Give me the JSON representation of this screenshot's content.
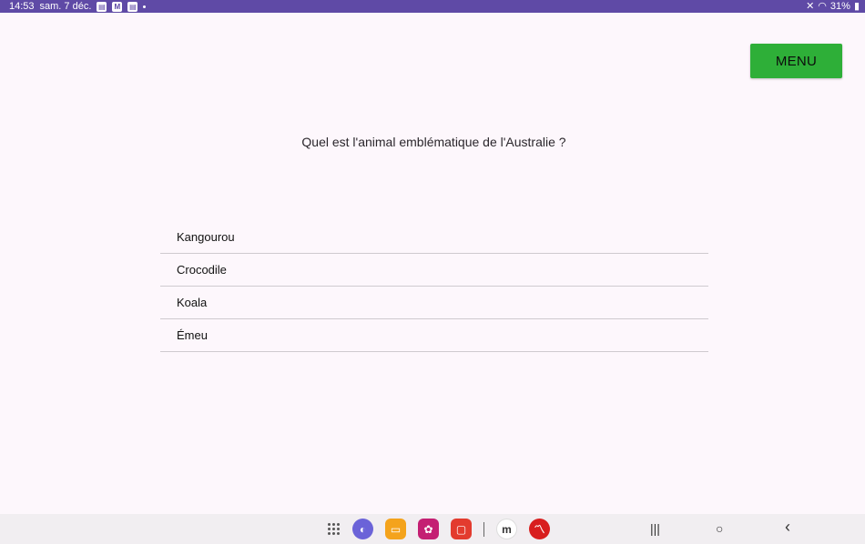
{
  "status_bar": {
    "time": "14:53",
    "date": "sam. 7 déc.",
    "battery": "31%"
  },
  "menu": {
    "label": "MENU"
  },
  "question": "Quel est l'animal emblématique de l'Australie ?",
  "answers": [
    "Kangourou",
    "Crocodile",
    "Koala",
    "Émeu"
  ],
  "colors": {
    "status_bar": "#5f4aa6",
    "menu_button": "#2eaf38",
    "background": "#fdf7fc"
  },
  "dock": {
    "apps": [
      "app-drawer-icon",
      "internet-icon",
      "files-icon",
      "gallery-icon",
      "notes-icon",
      "m-app-icon",
      "red-app-icon"
    ]
  },
  "nav": {
    "recents": "|||",
    "home": "○",
    "back": "‹"
  }
}
